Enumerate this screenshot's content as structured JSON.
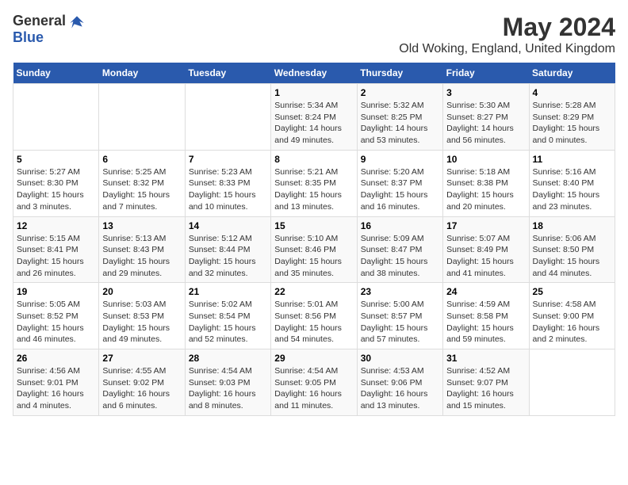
{
  "header": {
    "logo_general": "General",
    "logo_blue": "Blue",
    "title": "May 2024",
    "subtitle": "Old Woking, England, United Kingdom"
  },
  "days_of_week": [
    "Sunday",
    "Monday",
    "Tuesday",
    "Wednesday",
    "Thursday",
    "Friday",
    "Saturday"
  ],
  "weeks": [
    {
      "days": [
        {
          "number": "",
          "info": ""
        },
        {
          "number": "",
          "info": ""
        },
        {
          "number": "",
          "info": ""
        },
        {
          "number": "1",
          "info": "Sunrise: 5:34 AM\nSunset: 8:24 PM\nDaylight: 14 hours\nand 49 minutes."
        },
        {
          "number": "2",
          "info": "Sunrise: 5:32 AM\nSunset: 8:25 PM\nDaylight: 14 hours\nand 53 minutes."
        },
        {
          "number": "3",
          "info": "Sunrise: 5:30 AM\nSunset: 8:27 PM\nDaylight: 14 hours\nand 56 minutes."
        },
        {
          "number": "4",
          "info": "Sunrise: 5:28 AM\nSunset: 8:29 PM\nDaylight: 15 hours\nand 0 minutes."
        }
      ]
    },
    {
      "days": [
        {
          "number": "5",
          "info": "Sunrise: 5:27 AM\nSunset: 8:30 PM\nDaylight: 15 hours\nand 3 minutes."
        },
        {
          "number": "6",
          "info": "Sunrise: 5:25 AM\nSunset: 8:32 PM\nDaylight: 15 hours\nand 7 minutes."
        },
        {
          "number": "7",
          "info": "Sunrise: 5:23 AM\nSunset: 8:33 PM\nDaylight: 15 hours\nand 10 minutes."
        },
        {
          "number": "8",
          "info": "Sunrise: 5:21 AM\nSunset: 8:35 PM\nDaylight: 15 hours\nand 13 minutes."
        },
        {
          "number": "9",
          "info": "Sunrise: 5:20 AM\nSunset: 8:37 PM\nDaylight: 15 hours\nand 16 minutes."
        },
        {
          "number": "10",
          "info": "Sunrise: 5:18 AM\nSunset: 8:38 PM\nDaylight: 15 hours\nand 20 minutes."
        },
        {
          "number": "11",
          "info": "Sunrise: 5:16 AM\nSunset: 8:40 PM\nDaylight: 15 hours\nand 23 minutes."
        }
      ]
    },
    {
      "days": [
        {
          "number": "12",
          "info": "Sunrise: 5:15 AM\nSunset: 8:41 PM\nDaylight: 15 hours\nand 26 minutes."
        },
        {
          "number": "13",
          "info": "Sunrise: 5:13 AM\nSunset: 8:43 PM\nDaylight: 15 hours\nand 29 minutes."
        },
        {
          "number": "14",
          "info": "Sunrise: 5:12 AM\nSunset: 8:44 PM\nDaylight: 15 hours\nand 32 minutes."
        },
        {
          "number": "15",
          "info": "Sunrise: 5:10 AM\nSunset: 8:46 PM\nDaylight: 15 hours\nand 35 minutes."
        },
        {
          "number": "16",
          "info": "Sunrise: 5:09 AM\nSunset: 8:47 PM\nDaylight: 15 hours\nand 38 minutes."
        },
        {
          "number": "17",
          "info": "Sunrise: 5:07 AM\nSunset: 8:49 PM\nDaylight: 15 hours\nand 41 minutes."
        },
        {
          "number": "18",
          "info": "Sunrise: 5:06 AM\nSunset: 8:50 PM\nDaylight: 15 hours\nand 44 minutes."
        }
      ]
    },
    {
      "days": [
        {
          "number": "19",
          "info": "Sunrise: 5:05 AM\nSunset: 8:52 PM\nDaylight: 15 hours\nand 46 minutes."
        },
        {
          "number": "20",
          "info": "Sunrise: 5:03 AM\nSunset: 8:53 PM\nDaylight: 15 hours\nand 49 minutes."
        },
        {
          "number": "21",
          "info": "Sunrise: 5:02 AM\nSunset: 8:54 PM\nDaylight: 15 hours\nand 52 minutes."
        },
        {
          "number": "22",
          "info": "Sunrise: 5:01 AM\nSunset: 8:56 PM\nDaylight: 15 hours\nand 54 minutes."
        },
        {
          "number": "23",
          "info": "Sunrise: 5:00 AM\nSunset: 8:57 PM\nDaylight: 15 hours\nand 57 minutes."
        },
        {
          "number": "24",
          "info": "Sunrise: 4:59 AM\nSunset: 8:58 PM\nDaylight: 15 hours\nand 59 minutes."
        },
        {
          "number": "25",
          "info": "Sunrise: 4:58 AM\nSunset: 9:00 PM\nDaylight: 16 hours\nand 2 minutes."
        }
      ]
    },
    {
      "days": [
        {
          "number": "26",
          "info": "Sunrise: 4:56 AM\nSunset: 9:01 PM\nDaylight: 16 hours\nand 4 minutes."
        },
        {
          "number": "27",
          "info": "Sunrise: 4:55 AM\nSunset: 9:02 PM\nDaylight: 16 hours\nand 6 minutes."
        },
        {
          "number": "28",
          "info": "Sunrise: 4:54 AM\nSunset: 9:03 PM\nDaylight: 16 hours\nand 8 minutes."
        },
        {
          "number": "29",
          "info": "Sunrise: 4:54 AM\nSunset: 9:05 PM\nDaylight: 16 hours\nand 11 minutes."
        },
        {
          "number": "30",
          "info": "Sunrise: 4:53 AM\nSunset: 9:06 PM\nDaylight: 16 hours\nand 13 minutes."
        },
        {
          "number": "31",
          "info": "Sunrise: 4:52 AM\nSunset: 9:07 PM\nDaylight: 16 hours\nand 15 minutes."
        },
        {
          "number": "",
          "info": ""
        }
      ]
    }
  ]
}
